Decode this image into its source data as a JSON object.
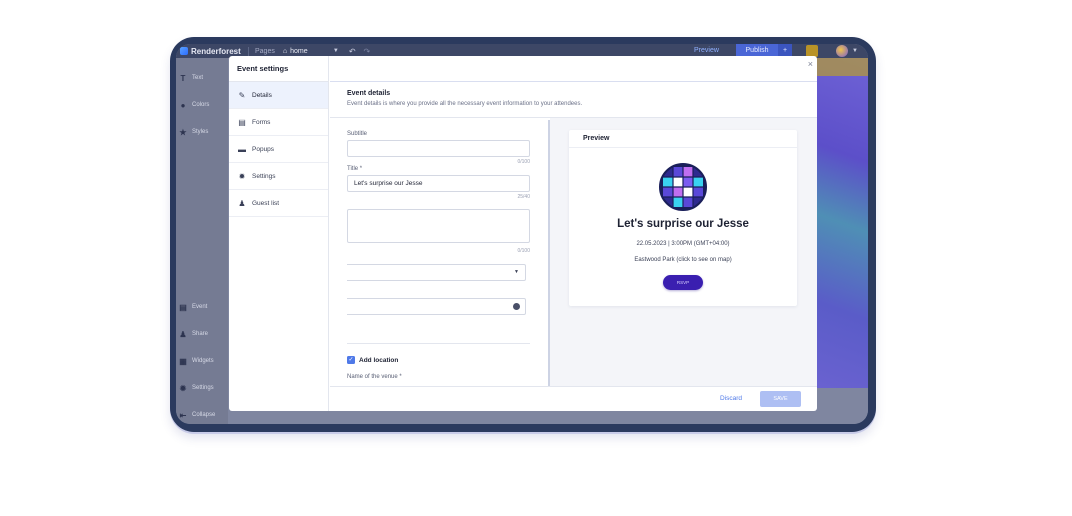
{
  "topbar": {
    "brand": "Renderforest",
    "pages_label": "Pages",
    "current_page": "home",
    "preview_label": "Preview",
    "publish_label": "Publish"
  },
  "tools": {
    "top": [
      {
        "label": "Text",
        "icon": "text-icon"
      },
      {
        "label": "Colors",
        "icon": "palette-icon"
      },
      {
        "label": "Styles",
        "icon": "star-icon"
      }
    ],
    "bottom": [
      {
        "label": "Event",
        "icon": "calendar-icon"
      },
      {
        "label": "Share",
        "icon": "share-icon"
      },
      {
        "label": "Widgets",
        "icon": "widgets-icon"
      },
      {
        "label": "Settings",
        "icon": "gear-icon"
      },
      {
        "label": "Collapse",
        "icon": "collapse-icon"
      }
    ]
  },
  "modal": {
    "title": "Event settings",
    "nav": [
      {
        "label": "Details",
        "icon": "edit-icon",
        "active": true
      },
      {
        "label": "Forms",
        "icon": "form-icon"
      },
      {
        "label": "Popups",
        "icon": "popup-icon"
      },
      {
        "label": "Settings",
        "icon": "gear-icon"
      },
      {
        "label": "Guest list",
        "icon": "person-icon"
      }
    ],
    "section_title": "Event details",
    "section_subtitle": "Event details is where you provide all the necessary event information to your attendees.",
    "form": {
      "subtitle_label": "Subtitle",
      "subtitle_value": "",
      "subtitle_count": "0/100",
      "title_label": "Title *",
      "title_value": "Let's surprise  our Jesse",
      "title_count": "25/40",
      "description_count": "0/100",
      "add_location_label": "Add location",
      "add_location_checked": true,
      "venue_label": "Name of the venue *"
    },
    "preview": {
      "heading": "Preview",
      "event_title": "Let's surprise our Jesse",
      "event_datetime": "22.05.2023 | 3:00PM (GMT+04:00)",
      "event_location": "Eastwood Park (click to see on map)",
      "rsvp_label": "RSVP"
    },
    "footer": {
      "discard_label": "Discard",
      "save_label": "SAVE"
    },
    "close_label": "×"
  },
  "colors": {
    "accent": "#4f79e8",
    "rsvp_bg": "#3a1fb0",
    "frame": "#2b3a5e"
  }
}
